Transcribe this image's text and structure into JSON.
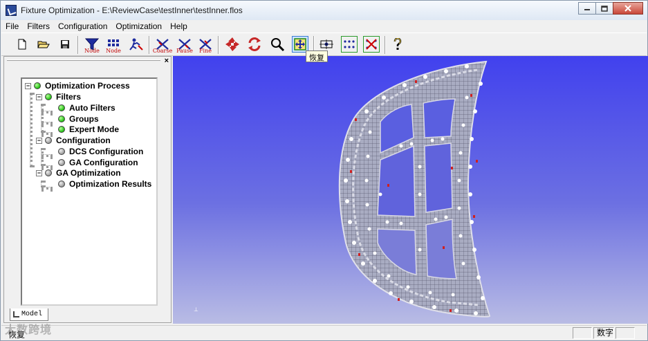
{
  "window": {
    "title": "Fixture Optimization - E:\\ReviewCase\\testInner\\testInner.flos",
    "controls": [
      "minimize",
      "maximize",
      "close"
    ]
  },
  "menu": [
    "File",
    "Filters",
    "Configuration",
    "Optimization",
    "Help"
  ],
  "toolbar": {
    "buttons": [
      {
        "name": "new-file-icon",
        "label": ""
      },
      {
        "name": "open-folder-icon",
        "label": ""
      },
      {
        "name": "save-disk-icon",
        "label": ""
      },
      {
        "name": "node-filter-icon",
        "label": "Node"
      },
      {
        "name": "node-grid-icon",
        "label": "Node"
      },
      {
        "name": "fixture-run-icon",
        "label": ""
      },
      {
        "name": "coarse-icon",
        "label": "Coarse"
      },
      {
        "name": "pause-icon",
        "label": "Pause"
      },
      {
        "name": "fine-icon",
        "label": "Fine"
      },
      {
        "name": "move-icon",
        "label": ""
      },
      {
        "name": "rotate-icon",
        "label": ""
      },
      {
        "name": "zoom-icon",
        "label": ""
      },
      {
        "name": "fit-view-icon",
        "label": ""
      },
      {
        "name": "center-view-icon",
        "label": ""
      },
      {
        "name": "point-grid-icon",
        "label": ""
      },
      {
        "name": "clear-selection-icon",
        "label": ""
      },
      {
        "name": "help-icon",
        "label": ""
      }
    ],
    "tooltip": "恢复"
  },
  "tree": {
    "nodes": [
      {
        "label": "Optimization Process",
        "status": "green",
        "level": 0,
        "expander": "-"
      },
      {
        "label": "Filters",
        "status": "green",
        "level": 1,
        "expander": "-"
      },
      {
        "label": "Auto Filters",
        "status": "green",
        "level": 2,
        "expander": ""
      },
      {
        "label": "Groups",
        "status": "green",
        "level": 2,
        "expander": ""
      },
      {
        "label": "Expert Mode",
        "status": "green",
        "level": 2,
        "expander": ""
      },
      {
        "label": "Configuration",
        "status": "gray",
        "level": 1,
        "expander": "-"
      },
      {
        "label": "DCS Configuration",
        "status": "gray",
        "level": 2,
        "expander": ""
      },
      {
        "label": "GA Configuration",
        "status": "gray",
        "level": 2,
        "expander": ""
      },
      {
        "label": "GA Optimization",
        "status": "gray",
        "level": 1,
        "expander": "-"
      },
      {
        "label": "Optimization Results",
        "status": "gray",
        "level": 2,
        "expander": ""
      }
    ],
    "tab_label": "Model",
    "close_glyph": "×"
  },
  "colors": {
    "viewport_top": "#4141ee",
    "viewport_bottom": "#b9bce4",
    "mesh": "#cfcfd6",
    "node_white": "#ffffff",
    "node_red": "#d02020",
    "status_green": "#1fbf10",
    "status_gray": "#9a9a9a"
  },
  "status": {
    "text": "恢复",
    "indicator": "数字"
  },
  "watermark": "大数跨境"
}
